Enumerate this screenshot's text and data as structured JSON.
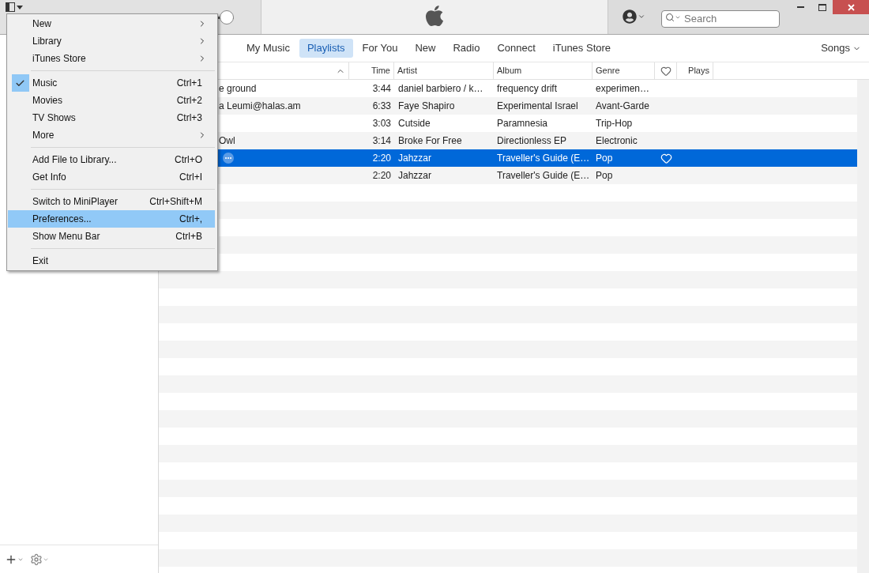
{
  "toolbar": {
    "volume": {
      "level": 1
    },
    "search": {
      "placeholder": "Search"
    }
  },
  "menu": {
    "items": [
      {
        "kind": "item",
        "label": "New",
        "submenu": true,
        "checked": false,
        "selected": false
      },
      {
        "kind": "item",
        "label": "Library",
        "submenu": true,
        "checked": false,
        "selected": false
      },
      {
        "kind": "item",
        "label": "iTunes Store",
        "submenu": true,
        "checked": false,
        "selected": false
      },
      {
        "kind": "separator"
      },
      {
        "kind": "item",
        "label": "Music",
        "shortcut": "Ctrl+1",
        "submenu": false,
        "checked": true,
        "selected": false
      },
      {
        "kind": "item",
        "label": "Movies",
        "shortcut": "Ctrl+2",
        "submenu": false,
        "checked": false,
        "selected": false
      },
      {
        "kind": "item",
        "label": "TV Shows",
        "shortcut": "Ctrl+3",
        "submenu": false,
        "checked": false,
        "selected": false
      },
      {
        "kind": "item",
        "label": "More",
        "submenu": true,
        "checked": false,
        "selected": false
      },
      {
        "kind": "separator"
      },
      {
        "kind": "item",
        "label": "Add File to Library...",
        "shortcut": "Ctrl+O",
        "submenu": false,
        "checked": false,
        "selected": false
      },
      {
        "kind": "item",
        "label": "Get Info",
        "shortcut": "Ctrl+I",
        "submenu": false,
        "checked": false,
        "selected": false
      },
      {
        "kind": "separator"
      },
      {
        "kind": "item",
        "label": "Switch to MiniPlayer",
        "shortcut": "Ctrl+Shift+M",
        "submenu": false,
        "checked": false,
        "selected": false
      },
      {
        "kind": "item",
        "label": "Preferences...",
        "shortcut": "Ctrl+,",
        "submenu": false,
        "checked": false,
        "selected": true
      },
      {
        "kind": "item",
        "label": "Show Menu Bar",
        "shortcut": "Ctrl+B",
        "submenu": false,
        "checked": false,
        "selected": false
      },
      {
        "kind": "separator"
      },
      {
        "kind": "item",
        "label": "Exit",
        "submenu": false,
        "checked": false,
        "selected": false
      }
    ]
  },
  "nav": {
    "tabs": [
      {
        "label": "My Music",
        "selected": false
      },
      {
        "label": "Playlists",
        "selected": true
      },
      {
        "label": "For You",
        "selected": false
      },
      {
        "label": "New",
        "selected": false
      },
      {
        "label": "Radio",
        "selected": false
      },
      {
        "label": "Connect",
        "selected": false
      },
      {
        "label": "iTunes Store",
        "selected": false
      }
    ],
    "view": "Songs"
  },
  "table": {
    "columns": [
      "Time",
      "Artist",
      "Album",
      "Genre",
      "Plays"
    ],
    "rows": [
      {
        "name": "e ground",
        "time": "3:44",
        "artist": "daniel barbiero / k…",
        "album": "frequency drift",
        "genre": "experimen…",
        "selected": false
      },
      {
        "name": "a Leumi@halas.am",
        "time": "6:33",
        "artist": "Faye Shapiro",
        "album": "Experimental Israel",
        "genre": "Avant-Garde",
        "selected": false
      },
      {
        "time": "3:03",
        "artist": "Cutside",
        "album": "Paramnesia",
        "genre": "Trip-Hop",
        "selected": false
      },
      {
        "name": "Owl",
        "time": "3:14",
        "artist": "Broke For Free",
        "album": "Directionless EP",
        "genre": "Electronic",
        "selected": false
      },
      {
        "time": "2:20",
        "artist": "Jahzzar",
        "album": "Traveller's Guide (E…",
        "genre": "Pop",
        "selected": true
      },
      {
        "time": "2:20",
        "artist": "Jahzzar",
        "album": "Traveller's Guide (E…",
        "genre": "Pop",
        "selected": false
      }
    ]
  }
}
